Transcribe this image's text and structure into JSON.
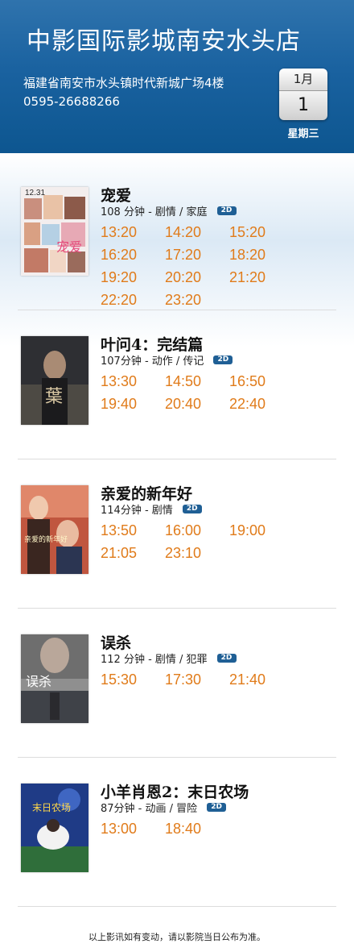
{
  "header": {
    "cinema_name": "中影国际影城南安水头店",
    "address": "福建省南安市水头镇时代新城广场4楼",
    "phone": "0595-26688266",
    "calendar": {
      "month": "1月",
      "day": "1",
      "weekday": "星期三"
    }
  },
  "movies": [
    {
      "title": "宠爱",
      "meta": "108 分钟 - 剧情 / 家庭",
      "format": "2D",
      "times": [
        "13:20",
        "14:20",
        "15:20",
        "16:20",
        "17:20",
        "18:20",
        "19:20",
        "20:20",
        "21:20",
        "22:20",
        "23:20"
      ],
      "poster_text": "12.31",
      "poster_overlay": "宠爱"
    },
    {
      "title": "叶问4：完结篇",
      "meta": "107分钟 - 动作 / 传记",
      "format": "2D",
      "times": [
        "13:30",
        "14:50",
        "16:50",
        "19:40",
        "20:40",
        "22:40"
      ],
      "poster_overlay": "葉"
    },
    {
      "title": "亲爱的新年好",
      "meta": "114分钟 - 剧情",
      "format": "2D",
      "times": [
        "13:50",
        "16:00",
        "19:00",
        "21:05",
        "23:10"
      ],
      "poster_overlay": "亲爱的新年好"
    },
    {
      "title": "误杀",
      "meta": "112 分钟 - 剧情 / 犯罪",
      "format": "2D",
      "times": [
        "15:30",
        "17:30",
        "21:40"
      ],
      "poster_overlay": "误杀"
    },
    {
      "title": "小羊肖恩2：末日农场",
      "meta": "87分钟 - 动画 / 冒险",
      "format": "2D",
      "times": [
        "13:00",
        "18:40"
      ],
      "poster_overlay": "末日农场"
    }
  ],
  "footer": {
    "note": "以上影讯如有变动，请以影院当日公布为准。"
  },
  "colors": {
    "header_blue": "#1a62a0",
    "time_orange": "#e07b1a",
    "badge_blue": "#1f5f95"
  }
}
